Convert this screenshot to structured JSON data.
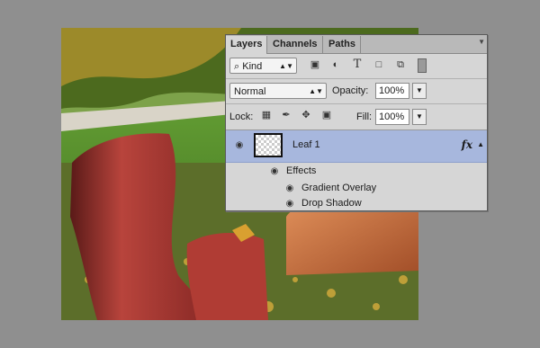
{
  "panel": {
    "tabs": [
      "Layers",
      "Channels",
      "Paths"
    ],
    "filter": {
      "kind_label": "Kind",
      "icons": [
        "image-filter-icon",
        "adjustment-filter-icon",
        "type-filter-icon",
        "shape-filter-icon",
        "smart-object-filter-icon",
        "filter-toggle-icon"
      ]
    },
    "blend": {
      "mode": "Normal",
      "opacity_label": "Opacity:",
      "opacity_value": "100%"
    },
    "lock": {
      "label": "Lock:",
      "fill_label": "Fill:",
      "fill_value": "100%",
      "icons": [
        "lock-transparent-icon",
        "lock-brush-icon",
        "lock-move-icon",
        "lock-all-icon"
      ]
    },
    "layer": {
      "name": "Leaf 1",
      "fx": "fx"
    },
    "effects": {
      "title": "Effects",
      "items": [
        "Gradient Overlay",
        "Drop Shadow"
      ]
    }
  },
  "colors": {
    "panel_bg": "#d6d6d6",
    "selected_row": "#a7b7dd",
    "canvas_bg": "#8f8f8f"
  }
}
